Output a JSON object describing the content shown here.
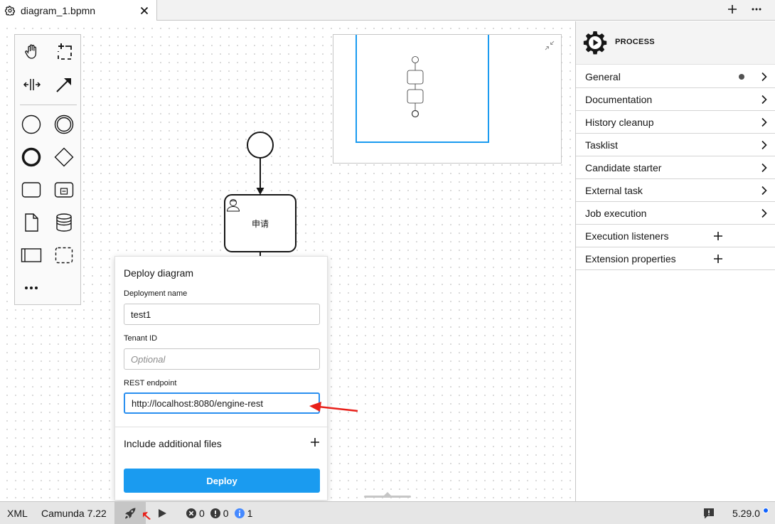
{
  "tab": {
    "title": "diagram_1.bpmn"
  },
  "diagram": {
    "task_label": "申请"
  },
  "deploy_dialog": {
    "title": "Deploy diagram",
    "deployment_name_label": "Deployment name",
    "deployment_name_value": "test1",
    "tenant_id_label": "Tenant ID",
    "tenant_id_placeholder": "Optional",
    "rest_endpoint_label": "REST endpoint",
    "rest_endpoint_value": "http://localhost:8080/engine-rest",
    "include_files_label": "Include additional files",
    "deploy_button": "Deploy",
    "button_color": "#1a9bf0"
  },
  "properties": {
    "header_title": "PROCESS",
    "groups": [
      {
        "label": "General",
        "action": "chevron",
        "has_dot": true
      },
      {
        "label": "Documentation",
        "action": "chevron"
      },
      {
        "label": "History cleanup",
        "action": "chevron"
      },
      {
        "label": "Tasklist",
        "action": "chevron"
      },
      {
        "label": "Candidate starter",
        "action": "chevron"
      },
      {
        "label": "External task",
        "action": "chevron"
      },
      {
        "label": "Job execution",
        "action": "chevron"
      },
      {
        "label": "Execution listeners",
        "action": "plus"
      },
      {
        "label": "Extension properties",
        "action": "plus"
      }
    ]
  },
  "statusbar": {
    "xml_label": "XML",
    "engine_label": "Camunda 7.22",
    "errors": "0",
    "warnings": "0",
    "infos": "1",
    "version": "5.29.0",
    "info_color": "#4589ff",
    "update_dot_color": "#0f62fe"
  },
  "annotation_color": "#e8201a"
}
